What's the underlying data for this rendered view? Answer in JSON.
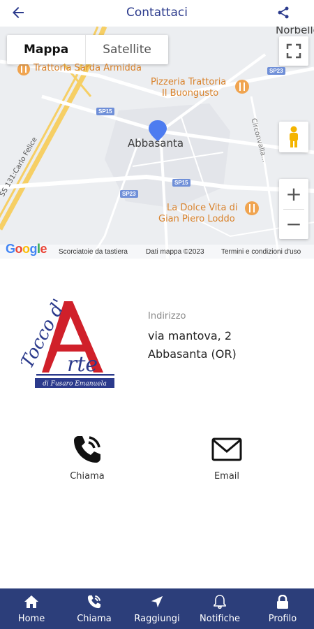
{
  "header": {
    "title": "Contattaci",
    "back_icon": "back-arrow-icon",
    "share_icon": "share-icon",
    "accent": "#2b3a8c"
  },
  "map": {
    "type_buttons": [
      "Mappa",
      "Satellite"
    ],
    "labels": {
      "norbello": "Norbello",
      "trattoria": "Trattoria Sarda Armidda",
      "pizzeria_1": "Pizzeria Trattoria",
      "pizzeria_2": "Il Buongusto",
      "town": "Abbasanta",
      "dolcevita_1": "La Dolce Vita di",
      "dolcevita_2": "Gian Piero Loddo",
      "sp15a": "SP15",
      "sp15b": "SP15",
      "sp23a": "SP23",
      "sp23b": "SP23",
      "ss131": "SS 131:Carlo Felice",
      "circonvallazione": "Circonvalla..."
    },
    "footer": {
      "google": "Google",
      "shortcuts": "Scorciatoie da tastiera",
      "mapdata": "Dati mappa ©2023",
      "terms": "Termini e condizioni d'uso"
    },
    "zoom_in": "+",
    "zoom_out": "−"
  },
  "logo": {
    "line1": "Tocco d'",
    "line2": "Arte",
    "tagline": "di Fusaro Emanuela"
  },
  "address": {
    "label": "Indirizzo",
    "line1": "via mantova, 2",
    "line2": "Abbasanta (OR)"
  },
  "actions": {
    "call": "Chiama",
    "email": "Email"
  },
  "nav": {
    "color": "#2c3e7a",
    "items": [
      {
        "label": "Home",
        "icon": "home-icon"
      },
      {
        "label": "Chiama",
        "icon": "phone-icon"
      },
      {
        "label": "Raggiungi",
        "icon": "navigation-icon"
      },
      {
        "label": "Notifiche",
        "icon": "bell-icon"
      },
      {
        "label": "Profilo",
        "icon": "lock-icon"
      }
    ]
  }
}
